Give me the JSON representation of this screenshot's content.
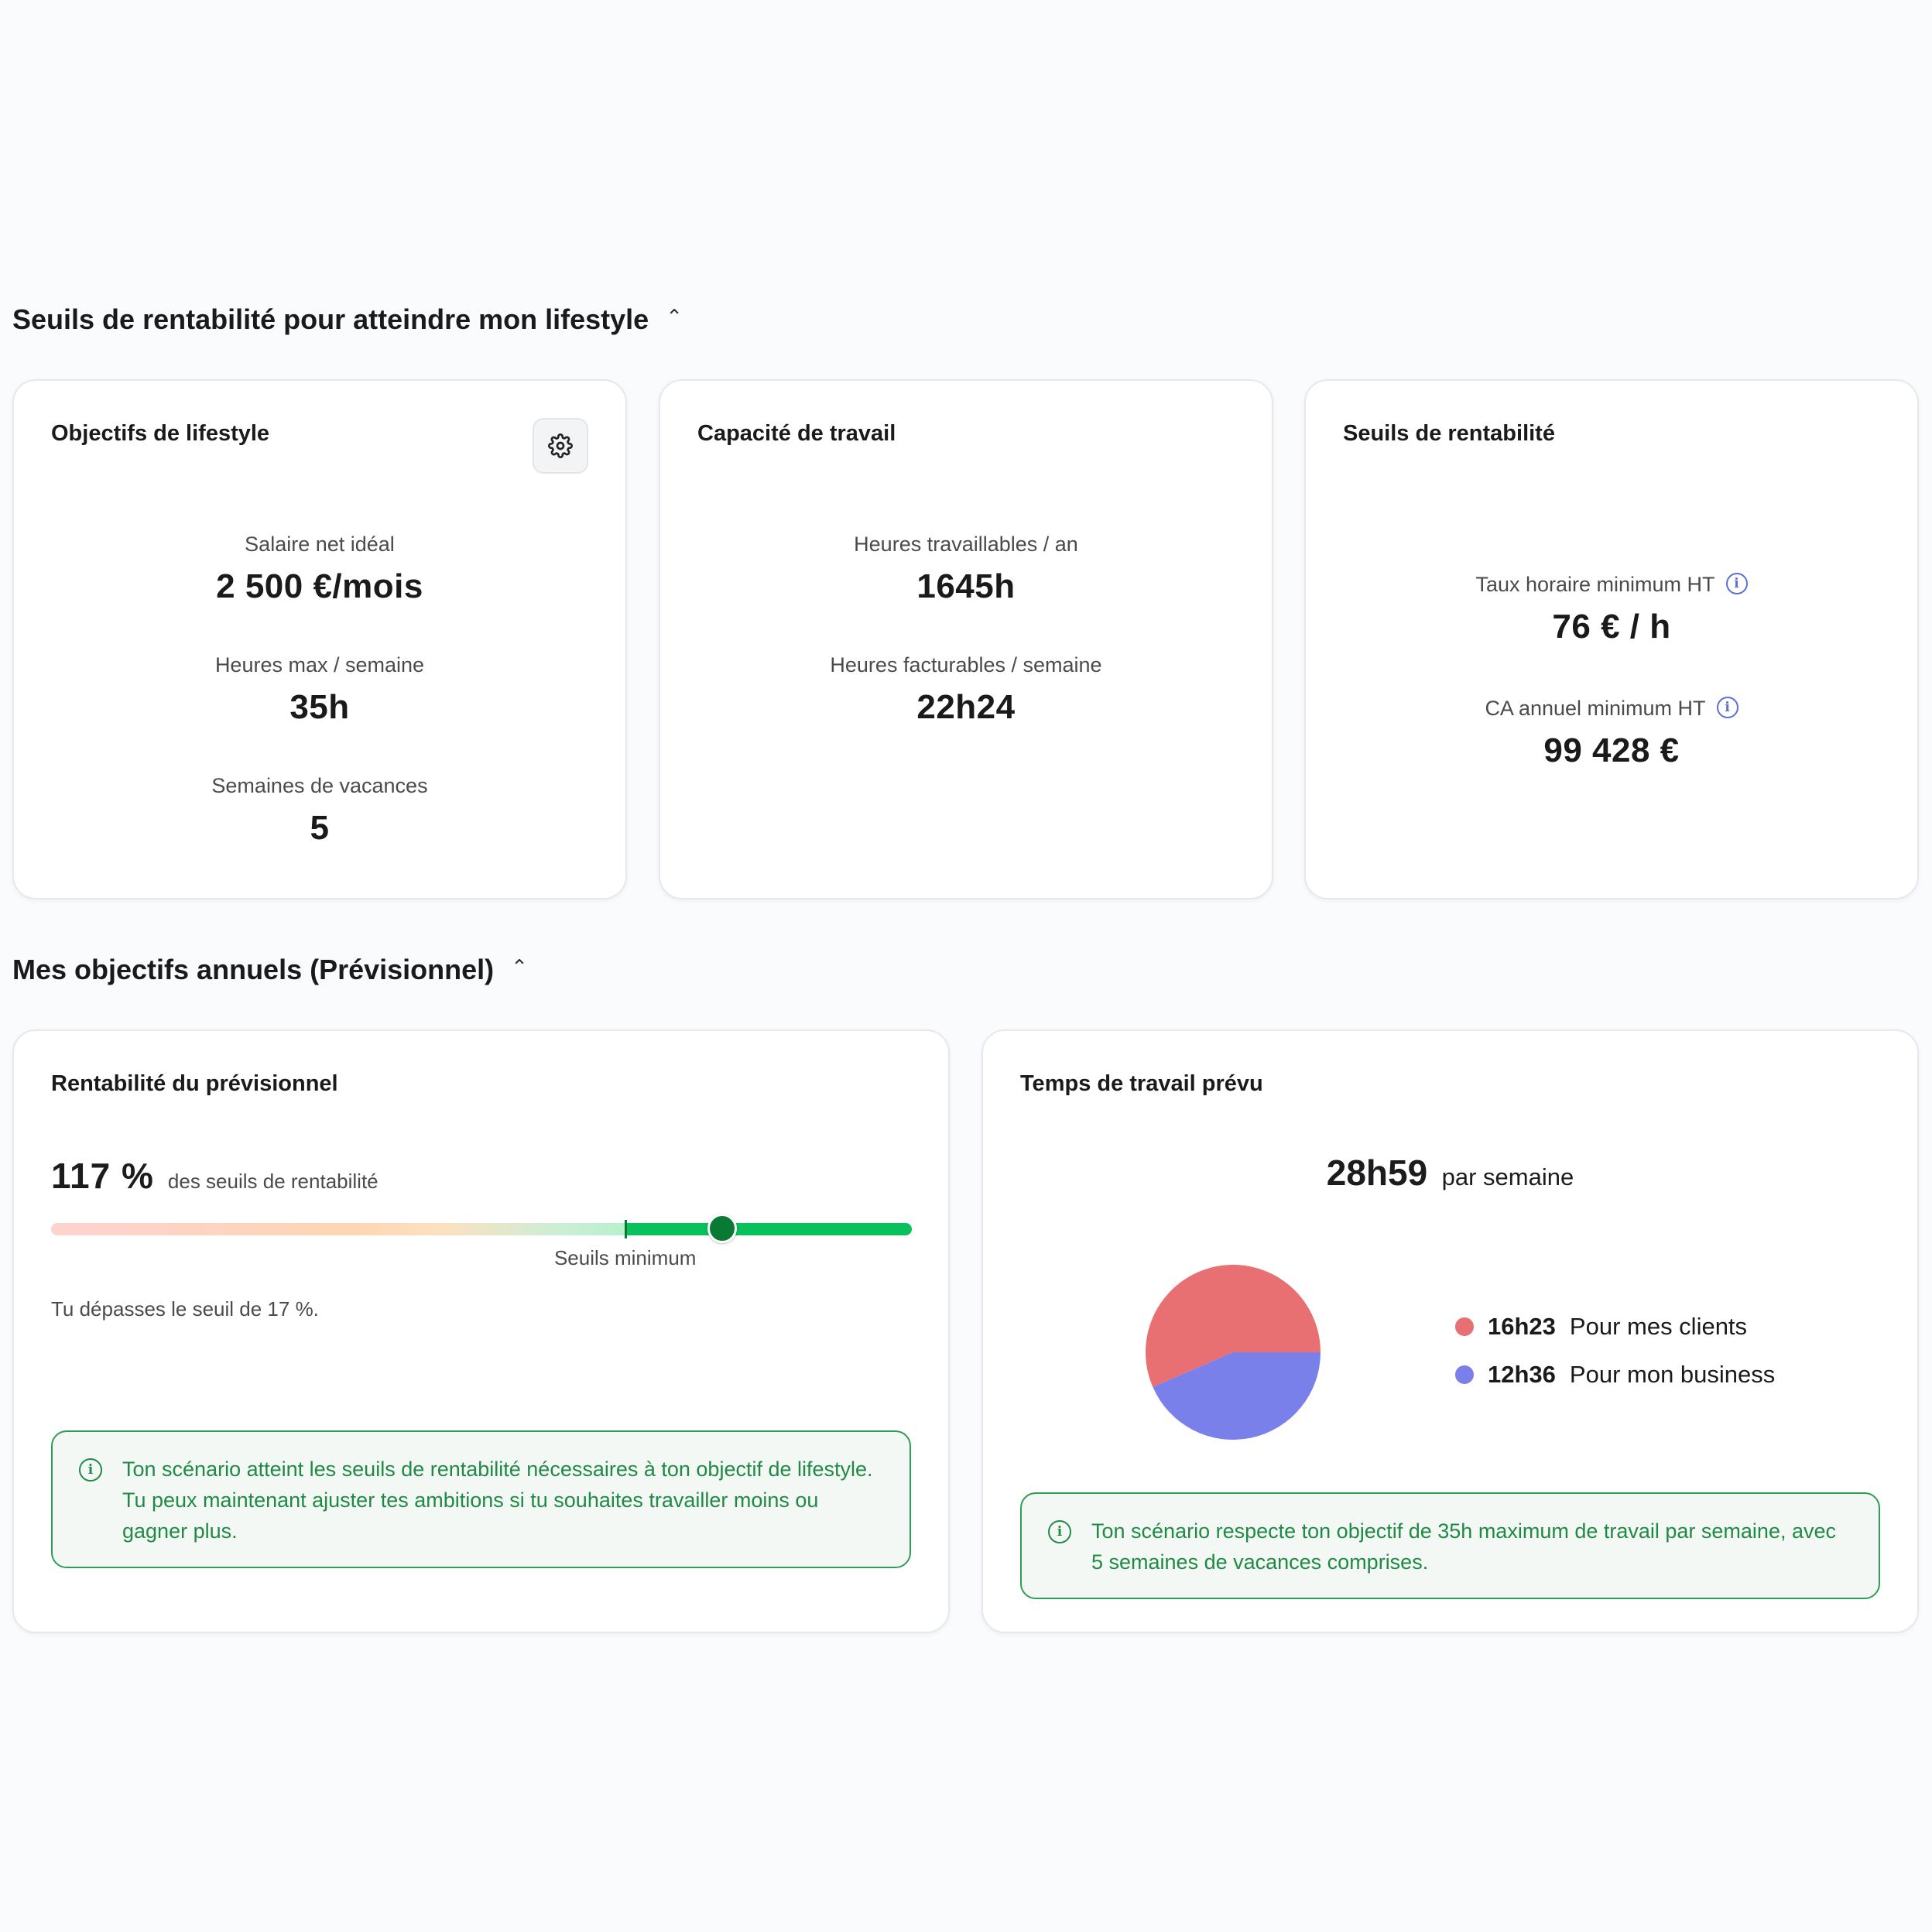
{
  "section1": {
    "title": "Seuils de rentabilité pour atteindre mon lifestyle"
  },
  "lifestyle": {
    "title": "Objectifs de lifestyle",
    "salary_label": "Salaire net idéal",
    "salary_value": "2 500 €/mois",
    "hours_label": "Heures max / semaine",
    "hours_value": "35h",
    "vacation_label": "Semaines de vacances",
    "vacation_value": "5"
  },
  "capacity": {
    "title": "Capacité de travail",
    "yearly_label": "Heures travaillables / an",
    "yearly_value": "1645h",
    "billable_label": "Heures facturables / semaine",
    "billable_value": "22h24"
  },
  "thresholds": {
    "title": "Seuils de rentabilité",
    "rate_label": "Taux horaire minimum HT",
    "rate_value": "76 € / h",
    "revenue_label": "CA annuel minimum HT",
    "revenue_value": "99 428 €"
  },
  "section2": {
    "title": "Mes objectifs annuels (Prévisionnel)"
  },
  "profitability": {
    "title": "Rentabilité du prévisionnel",
    "percent": "117 %",
    "percent_suffix": "des seuils de rentabilité",
    "progress": 0.78,
    "threshold_position": 0.667,
    "threshold_label": "Seuils minimum",
    "note": "Tu dépasses le seuil de 17 %.",
    "alert_line1": "Ton scénario atteint les seuils de rentabilité nécessaires à ton objectif de lifestyle.",
    "alert_line2": "Tu peux maintenant ajuster tes ambitions si tu souhaites travailler moins ou gagner plus."
  },
  "worktime": {
    "title": "Temps de travail prévu",
    "total": "28h59",
    "total_suffix": "par semaine",
    "alert": "Ton scénario respecte ton objectif de 35h maximum de travail par semaine, avec 5 semaines de vacances comprises."
  },
  "chart_data": {
    "type": "pie",
    "series": [
      {
        "name": "Pour mes clients",
        "label": "16h23",
        "value": 983,
        "color": "#e87073"
      },
      {
        "name": "Pour mon business",
        "label": "12h36",
        "value": 756,
        "color": "#7a80ea"
      }
    ],
    "legend": "right"
  }
}
